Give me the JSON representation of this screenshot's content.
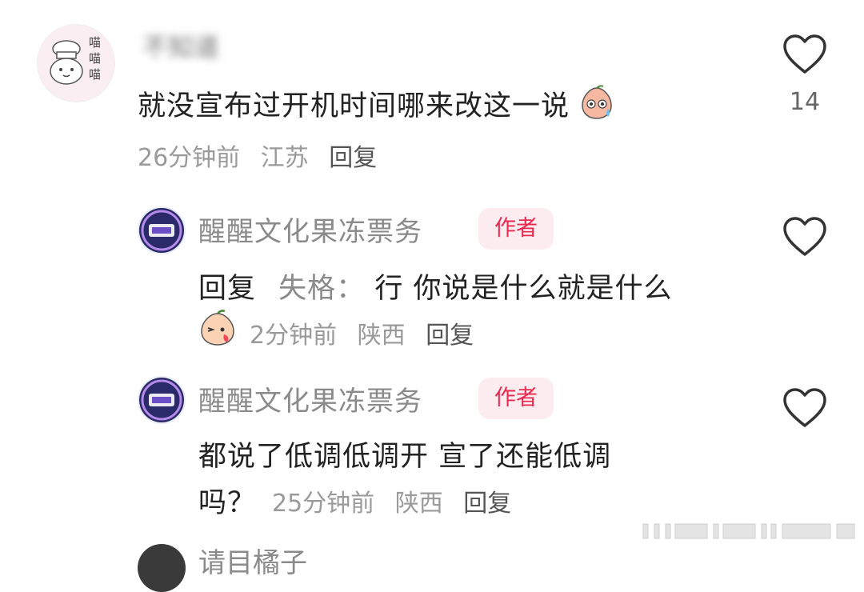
{
  "comment1": {
    "username": "不知道",
    "text": "就没宣布过开机时间哪来改这一说",
    "time": "26分钟前",
    "location": "江苏",
    "reply_label": "回复",
    "like_count": "14",
    "avatar_text": "喵喵喵"
  },
  "reply1": {
    "username": "醒醒文化果冻票务",
    "badge": "作者",
    "reply_prefix": "回复",
    "mention": "失格：",
    "text": "行 你说是什么就是什么",
    "time": "2分钟前",
    "location": "陕西",
    "reply_label": "回复"
  },
  "reply2": {
    "username": "醒醒文化果冻票务",
    "badge": "作者",
    "text_line1": "都说了低调低调开 宣了还能低调",
    "text_line2": "吗？",
    "time": "25分钟前",
    "location": "陕西",
    "reply_label": "回复"
  },
  "next_comment": {
    "username": "请目橘子"
  },
  "colors": {
    "badge_bg": "#fdecef",
    "badge_text": "#e8284f",
    "meta": "#9a9a9a",
    "author_name": "#8a8a8a"
  }
}
